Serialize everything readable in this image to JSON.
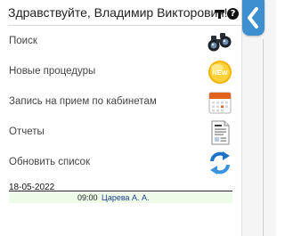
{
  "header": {
    "greeting": "Здравствуйте, Владимир Викторович!",
    "help_glyph": "?"
  },
  "menu": [
    {
      "label": "Поиск",
      "icon": "binoculars-icon"
    },
    {
      "label": "Новые процедуры",
      "icon": "new-badge-icon",
      "badge_text": "NEW"
    },
    {
      "label": "Запись на прием по кабинетам",
      "icon": "calendar-icon"
    },
    {
      "label": "Отчеты",
      "icon": "report-document-icon"
    },
    {
      "label": "Обновить список",
      "icon": "refresh-icon"
    }
  ],
  "schedule": {
    "date": "18-05-2022",
    "appointments": [
      {
        "time": "09:00",
        "name": "Царева А. А."
      }
    ]
  },
  "colors": {
    "accent": "#3d8fd0",
    "appointment_row": "#eefbe9",
    "link": "#1a3e8a",
    "badge": "#f2b200"
  }
}
